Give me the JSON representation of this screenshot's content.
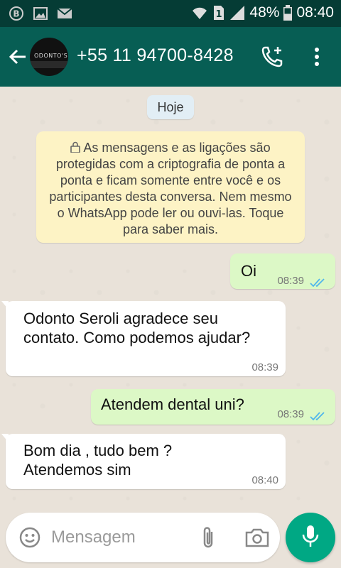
{
  "status_bar": {
    "battery": "48%",
    "time": "08:40",
    "sim_badge": "1",
    "icons": [
      "b-notification-icon",
      "gallery-icon",
      "mail-icon",
      "wifi-icon",
      "sim-icon",
      "signal-icon",
      "battery-icon"
    ]
  },
  "header": {
    "contact_title": "+55 11 94700-8428",
    "avatar_text": "ODONTO'S",
    "icons": [
      "back-arrow-icon",
      "add-call-icon",
      "more-vert-icon"
    ]
  },
  "chat": {
    "date_label": "Hoje",
    "encryption_notice": "As mensagens e as ligações são protegidas com a criptografia de ponta a ponta e ficam somente entre você e os participantes desta conversa. Nem mesmo o WhatsApp pode ler ou ouvi-las. Toque para saber mais.",
    "messages": [
      {
        "direction": "outgoing",
        "text": "Oi",
        "time": "08:39",
        "status": "read"
      },
      {
        "direction": "incoming",
        "text": "Odonto Seroli agradece seu\ncontato. Como podemos ajudar?",
        "time": "08:39"
      },
      {
        "direction": "outgoing",
        "text": "Atendem dental uni?",
        "time": "08:39",
        "status": "read"
      },
      {
        "direction": "incoming",
        "text": "Bom dia , tudo bem ?\nAtendemos sim",
        "time": "08:40"
      }
    ]
  },
  "composer": {
    "placeholder": "Mensagem",
    "icons": [
      "emoji-icon",
      "attach-icon",
      "camera-icon",
      "mic-icon"
    ]
  },
  "colors": {
    "header": "#075e54",
    "status_bar": "#053c35",
    "outgoing_bubble": "#dcf8c6",
    "incoming_bubble": "#ffffff",
    "notice_bg": "#fdf3c5",
    "read_ticks": "#4fb6ec",
    "mic_button": "#00a884"
  }
}
